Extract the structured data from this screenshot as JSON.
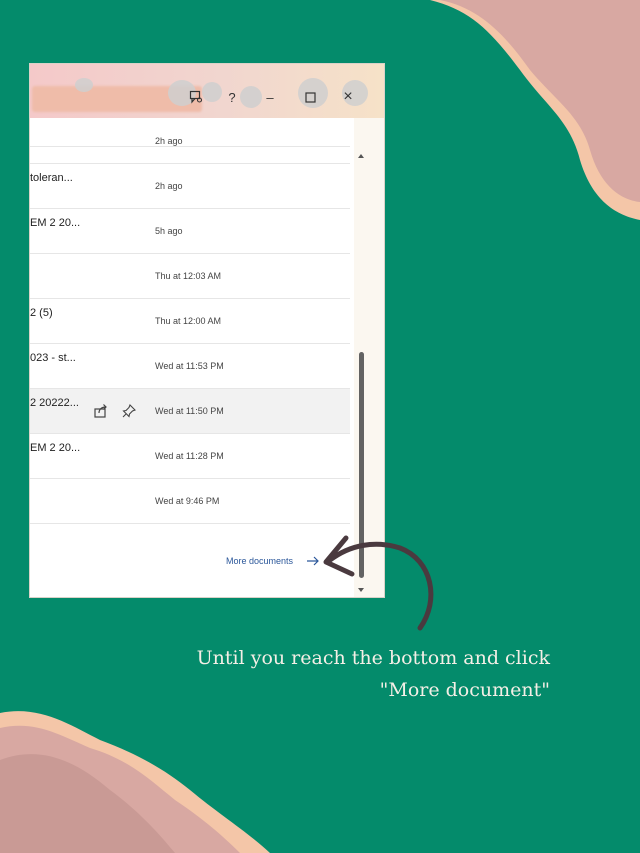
{
  "window": {
    "titlebar": {
      "feedback_icon": "feedback-icon",
      "help_label": "?",
      "minimize_label": "–",
      "maximize_icon": "maximize-icon",
      "close_label": "×"
    },
    "files": [
      {
        "name": "",
        "time": "2h ago",
        "highlighted": false
      },
      {
        "name": "toleran...",
        "time": "2h ago",
        "highlighted": false
      },
      {
        "name": "EM 2 20...",
        "time": "5h ago",
        "highlighted": false
      },
      {
        "name": "",
        "time": "Thu at 12:03 AM",
        "highlighted": false
      },
      {
        "name": "2 (5)",
        "time": "Thu at 12:00 AM",
        "highlighted": false
      },
      {
        "name": "023 - st...",
        "time": "Wed at 11:53 PM",
        "highlighted": false
      },
      {
        "name": "2 20222...",
        "time": "Wed at 11:50 PM",
        "highlighted": true
      },
      {
        "name": "EM 2 20...",
        "time": "Wed at 11:28 PM",
        "highlighted": false
      },
      {
        "name": "",
        "time": "Wed at 9:46 PM",
        "highlighted": false
      }
    ],
    "more_documents_label": "More documents"
  },
  "caption": {
    "line1": "Until you reach the bottom and click",
    "line2": "\"More document\""
  },
  "colors": {
    "background": "#048b6b",
    "blob_pink": "#d8a8a2",
    "blob_peach": "#f4c6a8",
    "link": "#2b579a",
    "annotation_arrow": "#4a3a3f"
  }
}
